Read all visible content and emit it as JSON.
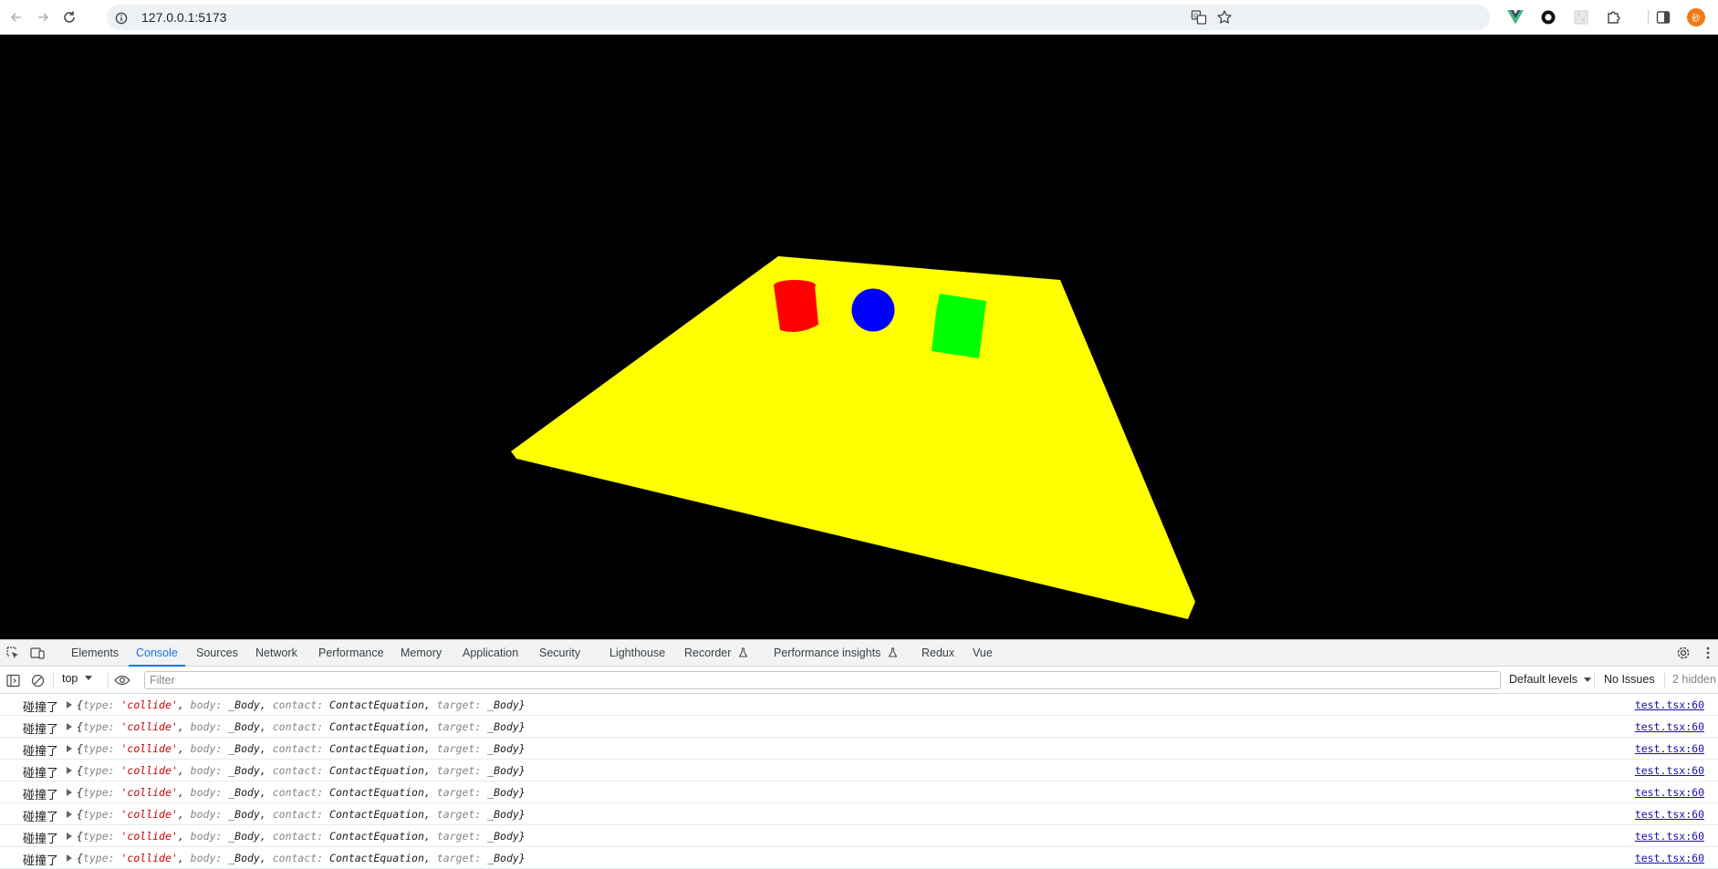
{
  "browser": {
    "url": "127.0.0.1:5173",
    "avatar_text": "砂"
  },
  "scene": {
    "background_color": "#000000",
    "plane_color": "#ffff00",
    "objects": [
      {
        "shape": "cylinder",
        "color": "#ff0000"
      },
      {
        "shape": "sphere",
        "color": "#0000ff"
      },
      {
        "shape": "box",
        "color": "#00ff00"
      }
    ]
  },
  "devtools": {
    "tabs": [
      {
        "label": "Elements"
      },
      {
        "label": "Console"
      },
      {
        "label": "Sources"
      },
      {
        "label": "Network"
      },
      {
        "label": "Performance"
      },
      {
        "label": "Memory"
      },
      {
        "label": "Application"
      },
      {
        "label": "Security"
      },
      {
        "label": "Lighthouse"
      },
      {
        "label": "Recorder"
      },
      {
        "label": "Performance insights"
      },
      {
        "label": "Redux"
      },
      {
        "label": "Vue"
      }
    ],
    "active_tab": "Console",
    "toolbar": {
      "context": "top",
      "filter_placeholder": "Filter",
      "levels": "Default levels",
      "issues": "No Issues",
      "hidden": "2 hidden"
    },
    "log_entry": {
      "prefix": "碰撞了",
      "type_key": "type",
      "type_value": "'collide'",
      "body_key": "body",
      "body_value": "_Body",
      "contact_key": "contact",
      "contact_value": "ContactEquation",
      "target_key": "target",
      "target_value": "_Body",
      "source": "test.tsx:60"
    },
    "log_count": 8
  }
}
